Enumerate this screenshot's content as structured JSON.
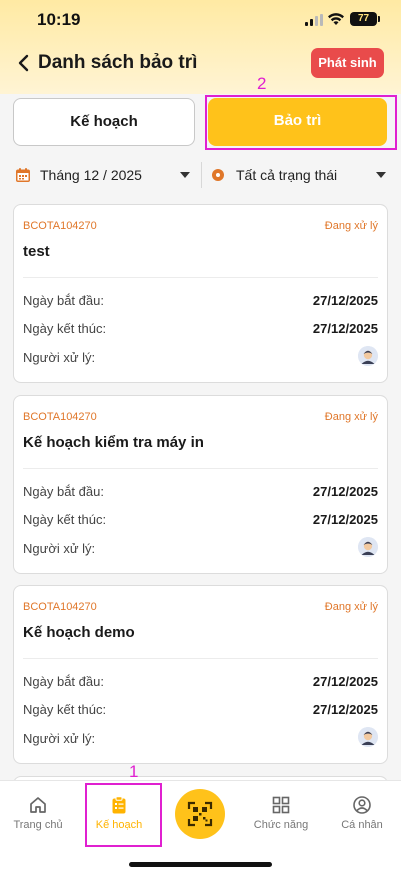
{
  "status_bar": {
    "time": "10:19",
    "battery": "77"
  },
  "header": {
    "title": "Danh sách bảo trì",
    "action_label": "Phát sinh"
  },
  "tabs": [
    {
      "label": "Kế hoạch",
      "active": false
    },
    {
      "label": "Bảo trì",
      "active": true
    }
  ],
  "filters": {
    "month": "Tháng 12 / 2025",
    "status": "Tất cả trạng thái"
  },
  "cards": [
    {
      "code": "BCOTA104270",
      "status": "Đang xử lý",
      "title": "test",
      "start_label": "Ngày bắt đầu:",
      "start_value": "27/12/2025",
      "end_label": "Ngày kết thúc:",
      "end_value": "27/12/2025",
      "handler_label": "Người xử lý:"
    },
    {
      "code": "BCOTA104270",
      "status": "Đang xử lý",
      "title": "Kế hoạch kiểm tra máy in",
      "start_label": "Ngày bắt đầu:",
      "start_value": "27/12/2025",
      "end_label": "Ngày kết thúc:",
      "end_value": "27/12/2025",
      "handler_label": "Người xử lý:"
    },
    {
      "code": "BCOTA104270",
      "status": "Đang xử lý",
      "title": "Kế hoạch demo",
      "start_label": "Ngày bắt đầu:",
      "start_value": "27/12/2025",
      "end_label": "Ngày kết thúc:",
      "end_value": "27/12/2025",
      "handler_label": "Người xử lý:"
    }
  ],
  "bottom_nav": [
    {
      "label": "Trang chủ",
      "icon": "home-icon"
    },
    {
      "label": "Kế hoạch",
      "icon": "clipboard-icon",
      "active": true
    },
    {
      "label": "",
      "icon": "qr-scan-icon"
    },
    {
      "label": "Chức năng",
      "icon": "grid-icon"
    },
    {
      "label": "Cá nhân",
      "icon": "user-icon"
    }
  ],
  "annotations": {
    "first": "1",
    "second": "2"
  },
  "colors": {
    "accent": "#ffc21a",
    "danger": "#e94b4b",
    "status": "#e0772a",
    "annotation": "#e020d0"
  }
}
